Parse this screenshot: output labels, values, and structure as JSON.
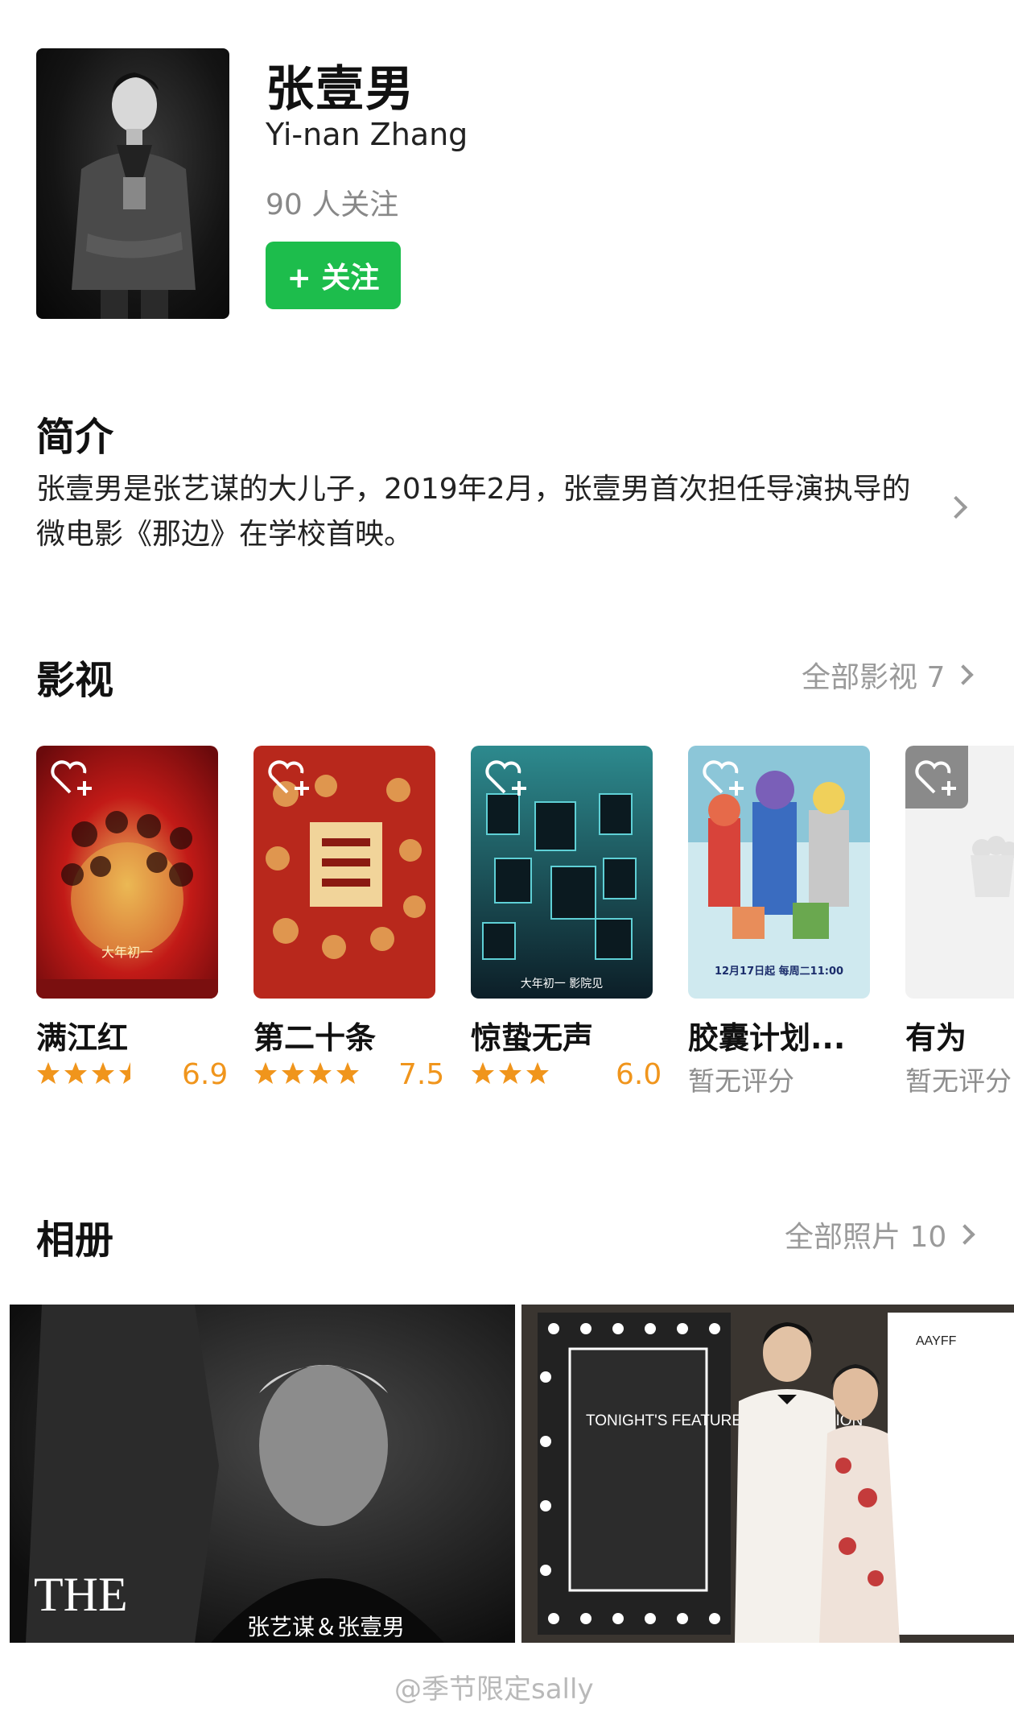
{
  "profile": {
    "name": "张壹男",
    "english_name": "Yi-nan Zhang",
    "followers": "90 人关注",
    "follow_label": "+ 关注"
  },
  "intro": {
    "title": "简介",
    "text": "张壹男是张艺谋的大儿子，2019年2月，张壹男首次担任导演执导的微电影《那边》在学校首映。"
  },
  "films": {
    "title": "影视",
    "all_label": "全部影视 7",
    "items": [
      {
        "title": "满江红",
        "stars": 3.5,
        "score": "6.9",
        "color1": "#b8141a",
        "color2": "#e0a24a"
      },
      {
        "title": "第二十条",
        "stars": 4,
        "score": "7.5",
        "color1": "#c02a1e",
        "color2": "#f0c067"
      },
      {
        "title": "惊蛰无声",
        "stars": 3,
        "score": "6.0",
        "color1": "#0f2c35",
        "color2": "#2a7f86"
      },
      {
        "title": "胶囊计划...",
        "stars": 0,
        "score": "暂无评分",
        "color1": "#6ab7cf",
        "color2": "#e67f6a"
      },
      {
        "title": "有为",
        "stars": 0,
        "score": "暂无评分",
        "color1": "#f2f2f2",
        "color2": "#e6e6e6"
      }
    ],
    "poster1_caption": "大年初一",
    "poster3_caption": "大年初一 影院见",
    "poster4_caption": "12月17日起 每周二11:00"
  },
  "album": {
    "title": "相册",
    "all_label": "全部照片 10",
    "photo1_caption_en": "THE",
    "photo1_caption_cn": "张艺谋＆张壹男",
    "photo2_sign": "TONIGHT'S FEATURE PRESENTATION",
    "photo2_banner": "AAYFF"
  },
  "watermark": "@季节限定sally",
  "colors": {
    "accent_green": "#1dbd4c",
    "star_orange": "#f0951c",
    "muted": "#8e8e8e"
  }
}
